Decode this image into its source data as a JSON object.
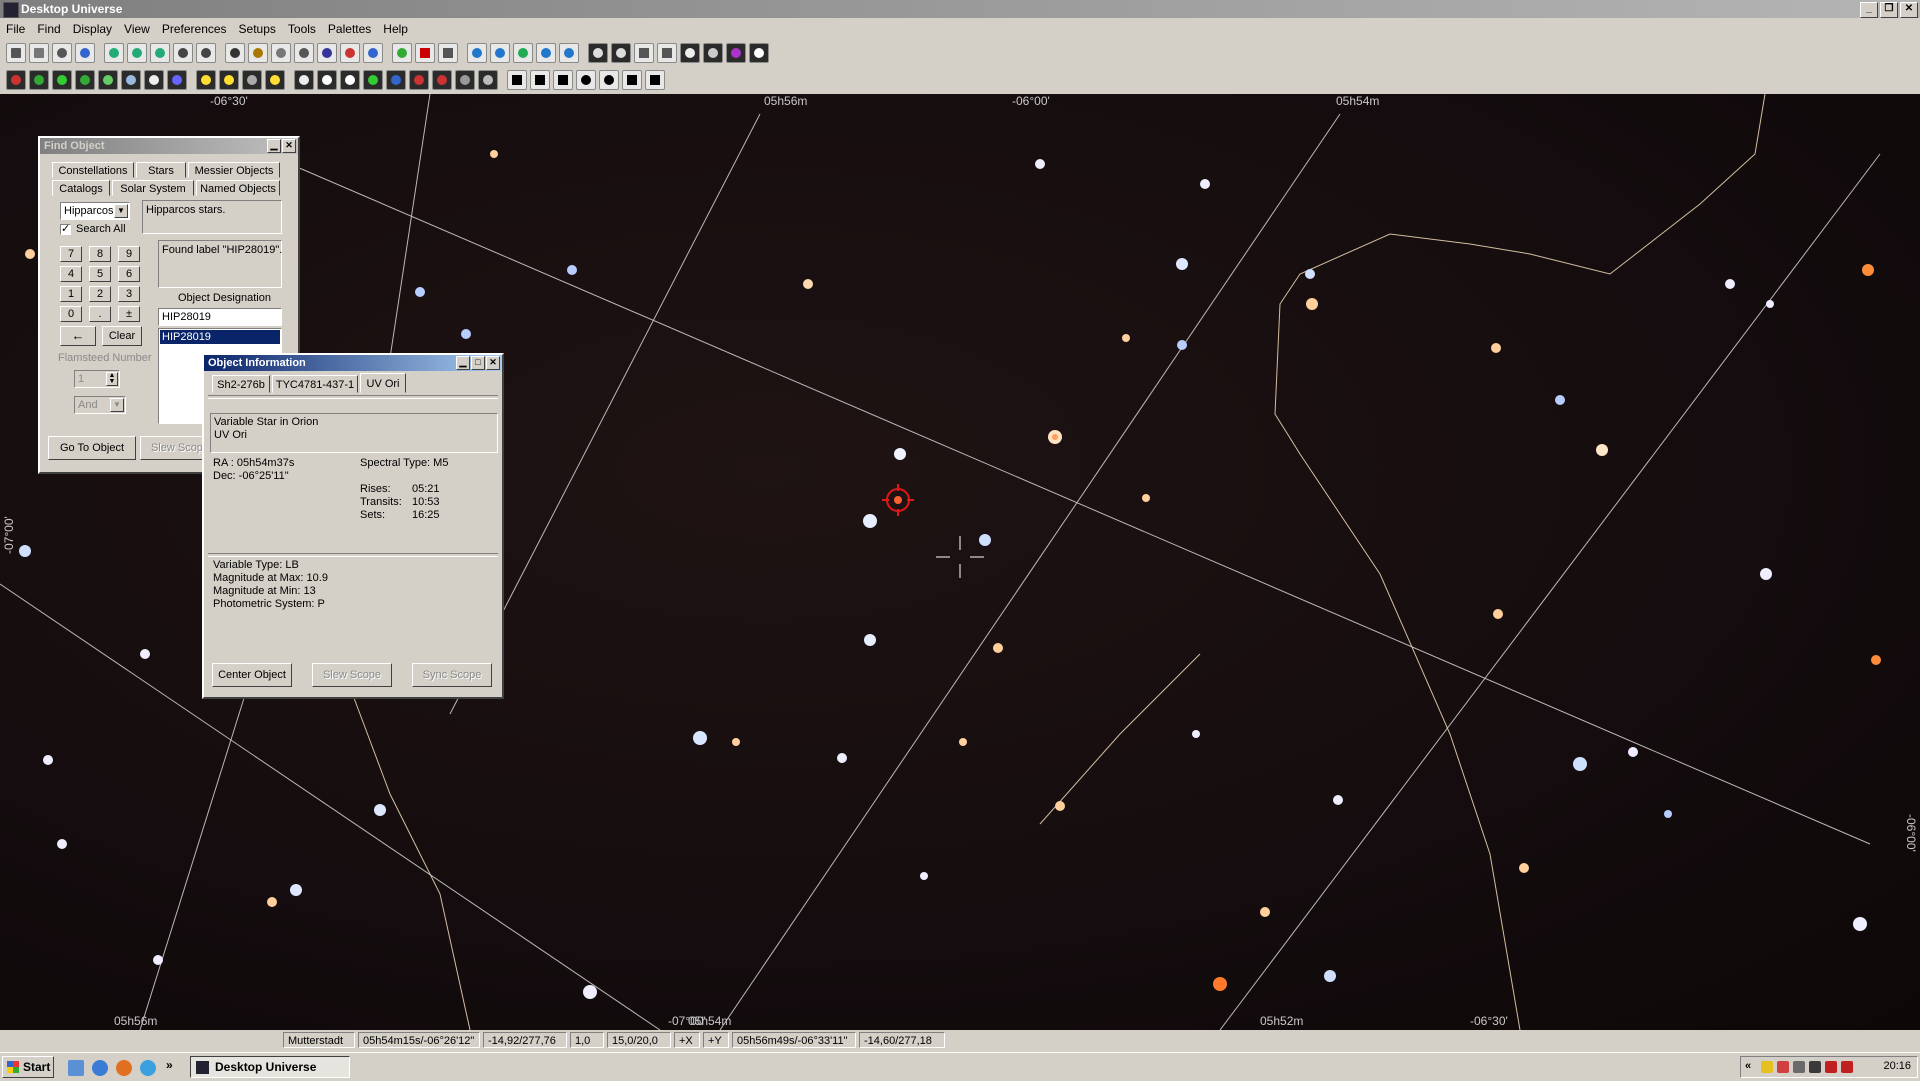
{
  "app": {
    "title": "Desktop Universe"
  },
  "menu": [
    "File",
    "Find",
    "Display",
    "View",
    "Preferences",
    "Setups",
    "Tools",
    "Palettes",
    "Help"
  ],
  "sky": {
    "ra_labels": [
      "05h56m",
      "05h54m",
      "05h56m",
      "05h54m",
      "05h52m"
    ],
    "dec_labels": [
      "-06°30'",
      "-06°00'",
      "-07°00'",
      "-06°30'",
      "-07°00'",
      "-06°00'"
    ]
  },
  "find_object": {
    "title": "Find Object",
    "tabs_row1": [
      "Constellations",
      "Stars",
      "Messier Objects"
    ],
    "tabs_row2": [
      "Catalogs",
      "Solar System",
      "Named Objects"
    ],
    "catalog_select": "Hipparcos",
    "search_all_label": "Search All",
    "search_all_checked": true,
    "description": "Hipparcos stars.",
    "found_text": "Found label \"HIP28019\".",
    "numpad": [
      "7",
      "8",
      "9",
      "4",
      "5",
      "6",
      "1",
      "2",
      "3",
      "0",
      ".",
      "±"
    ],
    "backspace": "←",
    "clear": "Clear",
    "designation_label": "Object Designation",
    "designation_value": "HIP28019",
    "results": [
      "HIP28019"
    ],
    "flamsteed_label": "Flamsteed Number",
    "flamsteed_value": "1",
    "and_select": "And",
    "goto_button": "Go To Object",
    "slew_button": "Slew Scope"
  },
  "object_info": {
    "title": "Object Information",
    "tabs": [
      "Sh2-276b",
      "TYC4781-437-1",
      "UV Ori"
    ],
    "type_line": "Variable Star in Orion",
    "name_line": "UV Ori",
    "ra": "RA : 05h54m37s",
    "dec": "Dec: -06°25'11\"",
    "spectral": "Spectral Type: M5",
    "rises_label": "Rises:",
    "rises": "05:21",
    "transits_label": "Transits:",
    "transits": "10:53",
    "sets_label": "Sets:",
    "sets": "16:25",
    "variable_type": "Variable Type: LB",
    "mag_max": "Magnitude at Max: 10.9",
    "mag_min": "Magnitude at Min: 13",
    "photometric": "Photometric System: P",
    "center_button": "Center Object",
    "slew_button": "Slew Scope",
    "sync_button": "Sync Scope"
  },
  "status": [
    "Mutterstadt",
    "05h54m15s/-06°26'12\"",
    "-14,92/277,76",
    "1,0",
    "15,0/20,0",
    "+X",
    "+Y",
    "05h56m49s/-06°33'11\"",
    "-14,60/277,18"
  ],
  "taskbar": {
    "start": "Start",
    "task": "Desktop Universe",
    "clock": "20:16",
    "chevrons": "»",
    "tray_arrow": "«"
  }
}
